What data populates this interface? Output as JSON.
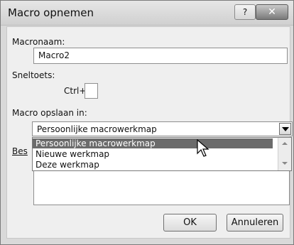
{
  "dialog": {
    "title": "Macro opnemen",
    "help_label": "?",
    "close_label": "✕"
  },
  "macro_name": {
    "label": "Macronaam:",
    "value": "Macro2"
  },
  "shortcut": {
    "label": "Sneltoets:",
    "prefix": "Ctrl+",
    "value": ""
  },
  "store_in": {
    "label": "Macro opslaan in:",
    "selected": "Persoonlijke macrowerkmap",
    "options": [
      "Persoonlijke macrowerkmap",
      "Nieuwe werkmap",
      "Deze werkmap"
    ]
  },
  "description": {
    "label_visible": "Bes"
  },
  "buttons": {
    "ok": "OK",
    "cancel": "Annuleren"
  },
  "icons": {
    "help": "help-icon",
    "close": "close-icon",
    "dropdown": "chevron-down-icon",
    "cursor": "mouse-pointer-icon"
  }
}
